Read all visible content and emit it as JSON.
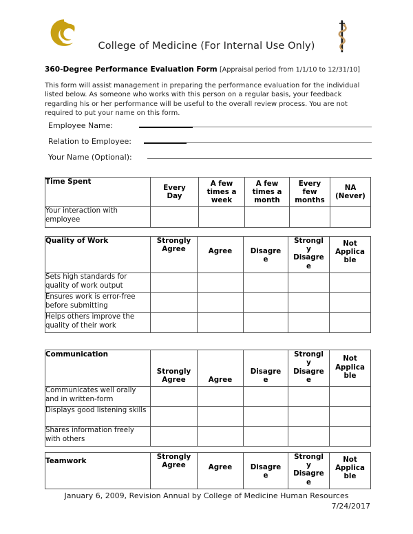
{
  "header": {
    "logo_left": "ucf-pegasus-logo",
    "logo_left_color": "#C8A013",
    "logo_right": "rod-of-asclepius-icon",
    "logo_right_color": "#C49A62",
    "title": "College of Medicine (For Internal Use Only)"
  },
  "subtitle": {
    "form_name": "360-Degree Performance Evaluation Form",
    "appraisal_period": "[Appraisal period from 1/1/10 to 12/31/10]"
  },
  "intro": {
    "text": "This form will assist management in preparing the performance evaluation for the individual listed below.  As someone who works with this person on a regular basis, your feedback regarding his or her performance will be useful to the overall review process.  You are not required to put your name on this form."
  },
  "fields": [
    {
      "label": "Employee Name:",
      "value": ""
    },
    {
      "label": "Relation to Employee:",
      "value": ""
    },
    {
      "label": "Your Name (Optional):",
      "value": ""
    }
  ],
  "tables": {
    "time_spent": {
      "category": "Time Spent",
      "columns": [
        "Every Day",
        "A few times a week",
        "A few times a month",
        "Every few months",
        "NA (Never)"
      ],
      "rows": [
        "Your interaction with employee"
      ]
    },
    "quality": {
      "category": "Quality of Work",
      "columns": [
        "Strongly Agree",
        "Agree",
        "Disagre e",
        "Strongl y Disagre e",
        "Not Applica ble"
      ],
      "rows": [
        "Sets high standards for quality of work output",
        "Ensures work is error-free before submitting",
        "Helps others improve the quality of their work"
      ]
    },
    "communication": {
      "category": "Communication",
      "columns": [
        "Strongly Agree",
        "Agree",
        "Disagre e",
        "Strongl y Disagre e",
        "Not Applica ble"
      ],
      "rows": [
        "Communicates well orally and in written-form",
        "Displays good listening skills",
        "Shares information freely with others"
      ]
    },
    "teamwork": {
      "category": "Teamwork",
      "columns": [
        "Strongly Agree",
        "Agree",
        "Disagre e",
        "Strongl y Disagre e",
        "Not Applica ble"
      ],
      "rows": []
    }
  },
  "column_parts": {
    "time": {
      "c1": [
        "Every",
        "Day"
      ],
      "c2": [
        "A few",
        "times a",
        "week"
      ],
      "c3": [
        "A few",
        "times a",
        "month"
      ],
      "c4": [
        "Every",
        "few",
        "months"
      ],
      "c5": [
        "NA",
        "(Never)"
      ]
    },
    "rate": {
      "c1": [
        "Strongly",
        "Agree"
      ],
      "c2": [
        "Agree"
      ],
      "c3": [
        "Disagre",
        "e"
      ],
      "c4": [
        "Strongl",
        "y",
        "Disagre",
        "e"
      ],
      "c5": [
        "Not",
        "Applica",
        "ble"
      ]
    }
  },
  "footer": {
    "revision": "January 6, 2009, Revision Annual by College of Medicine Human Resources",
    "date": "7/24/2017"
  }
}
